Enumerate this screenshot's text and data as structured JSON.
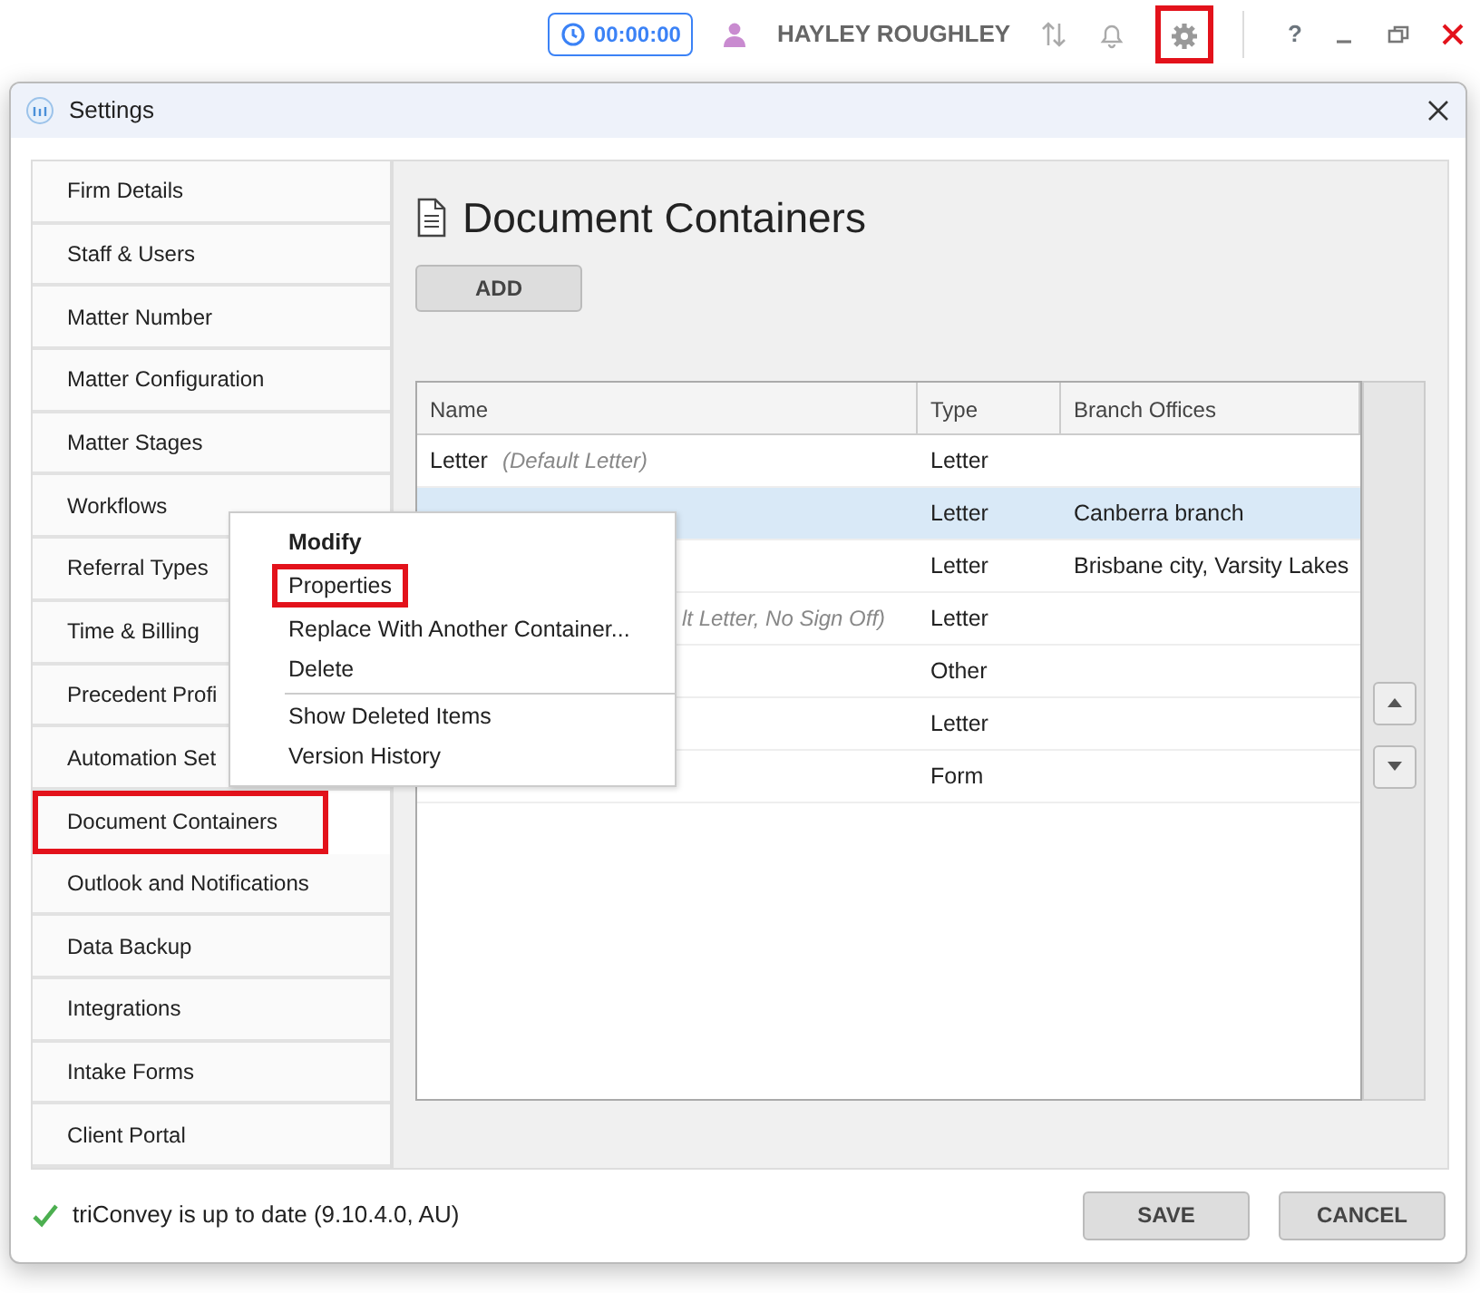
{
  "topbar": {
    "timer": "00:00:00",
    "user": "HAYLEY ROUGHLEY",
    "settings_highlighted": true,
    "help": "?"
  },
  "window": {
    "title": "Settings"
  },
  "sidebar": {
    "items": [
      {
        "label": "Firm Details",
        "highlighted": false
      },
      {
        "label": "Staff & Users",
        "highlighted": false
      },
      {
        "label": "Matter Number",
        "highlighted": false
      },
      {
        "label": "Matter Configuration",
        "highlighted": false
      },
      {
        "label": "Matter Stages",
        "highlighted": false
      },
      {
        "label": "Workflows",
        "highlighted": false
      },
      {
        "label": "Referral Types",
        "highlighted": false
      },
      {
        "label": "Time & Billing",
        "highlighted": false
      },
      {
        "label": "Precedent Profi",
        "highlighted": false
      },
      {
        "label": "Automation Set",
        "highlighted": false
      },
      {
        "label": "Document Containers",
        "highlighted": true
      },
      {
        "label": "Outlook and Notifications",
        "highlighted": false
      },
      {
        "label": "Data Backup",
        "highlighted": false
      },
      {
        "label": "Integrations",
        "highlighted": false
      },
      {
        "label": "Intake Forms",
        "highlighted": false
      },
      {
        "label": "Client Portal",
        "highlighted": false
      }
    ]
  },
  "content": {
    "heading": "Document Containers",
    "add_button": "ADD",
    "table": {
      "columns": [
        "Name",
        "Type",
        "Branch Offices"
      ],
      "rows": [
        {
          "name": "Letter",
          "note": "(Default Letter)",
          "type": "Letter",
          "branches": "",
          "selected": false
        },
        {
          "type": "Letter",
          "branches": "Canberra branch",
          "selected": true
        },
        {
          "type": "Letter",
          "branches": "Brisbane city, Varsity Lakes",
          "selected": false
        },
        {
          "note": "lt Letter, No Sign Off)",
          "type": "Letter",
          "branches": "",
          "selected": false
        },
        {
          "type": "Other",
          "branches": "",
          "selected": false
        },
        {
          "type": "Letter",
          "branches": "",
          "selected": false
        },
        {
          "type": "Form",
          "branches": "",
          "selected": false
        }
      ]
    }
  },
  "context_menu": {
    "items": [
      {
        "kind": "item",
        "label": "Modify",
        "bold": true,
        "highlighted": false
      },
      {
        "kind": "item",
        "label": "Properties",
        "bold": false,
        "highlighted": true
      },
      {
        "kind": "item",
        "label": "Replace With Another Container...",
        "bold": false,
        "highlighted": false
      },
      {
        "kind": "item",
        "label": "Delete",
        "bold": false,
        "highlighted": false
      },
      {
        "kind": "separator"
      },
      {
        "kind": "item",
        "label": "Show Deleted Items",
        "bold": false,
        "highlighted": false
      },
      {
        "kind": "item",
        "label": "Version History",
        "bold": false,
        "highlighted": false
      }
    ]
  },
  "footer": {
    "status": "triConvey is up to date (9.10.4.0, AU)",
    "buttons": [
      "SAVE",
      "CANCEL"
    ]
  }
}
